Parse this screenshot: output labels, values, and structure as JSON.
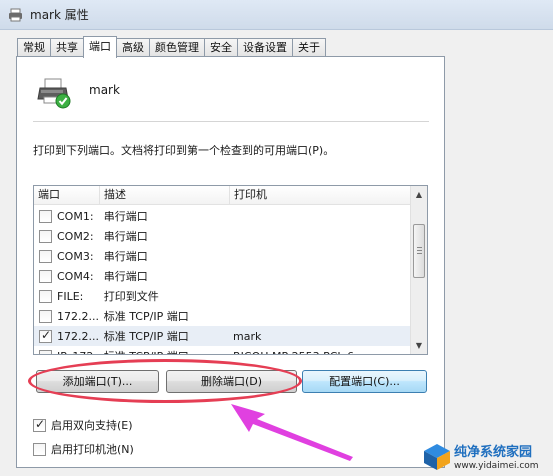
{
  "window": {
    "title": "mark 属性"
  },
  "tabs": [
    {
      "label": "常规"
    },
    {
      "label": "共享"
    },
    {
      "label": "端口"
    },
    {
      "label": "高级"
    },
    {
      "label": "颜色管理"
    },
    {
      "label": "安全"
    },
    {
      "label": "设备设置"
    },
    {
      "label": "关于"
    }
  ],
  "active_tab": "端口",
  "printer": {
    "name": "mark",
    "icon": "printer-check-icon"
  },
  "instruction": "打印到下列端口。文档将打印到第一个检查到的可用端口(P)。",
  "port_list": {
    "headers": [
      "端口",
      "描述",
      "打印机"
    ],
    "rows": [
      {
        "port": "COM1:",
        "desc": "串行端口",
        "printer": "",
        "checked": false
      },
      {
        "port": "COM2:",
        "desc": "串行端口",
        "printer": "",
        "checked": false
      },
      {
        "port": "COM3:",
        "desc": "串行端口",
        "printer": "",
        "checked": false
      },
      {
        "port": "COM4:",
        "desc": "串行端口",
        "printer": "",
        "checked": false
      },
      {
        "port": "FILE:",
        "desc": "打印到文件",
        "printer": "",
        "checked": false
      },
      {
        "port": "172.2...",
        "desc": "标准 TCP/IP 端口",
        "printer": "",
        "checked": false
      },
      {
        "port": "172.2...",
        "desc": "标准 TCP/IP 端口",
        "printer": "mark",
        "checked": true
      },
      {
        "port": "IP_172...",
        "desc": "标准 TCP/IP 端口",
        "printer": "RICOH MP 2553 PCL 6",
        "checked": false
      }
    ]
  },
  "buttons": {
    "add_port": "添加端口(T)...",
    "delete_port": "删除端口(D)",
    "configure_port": "配置端口(C)..."
  },
  "options": {
    "bidirectional": {
      "label": "启用双向支持(E)",
      "checked": true
    },
    "pooling": {
      "label": "启用打印机池(N)",
      "checked": false
    }
  },
  "annotation": {
    "highlight_color": "#e53e54",
    "arrow_color": "#e040e0"
  },
  "watermark": {
    "text": "纯净系统家园",
    "url": "www.yidaimei.com"
  }
}
